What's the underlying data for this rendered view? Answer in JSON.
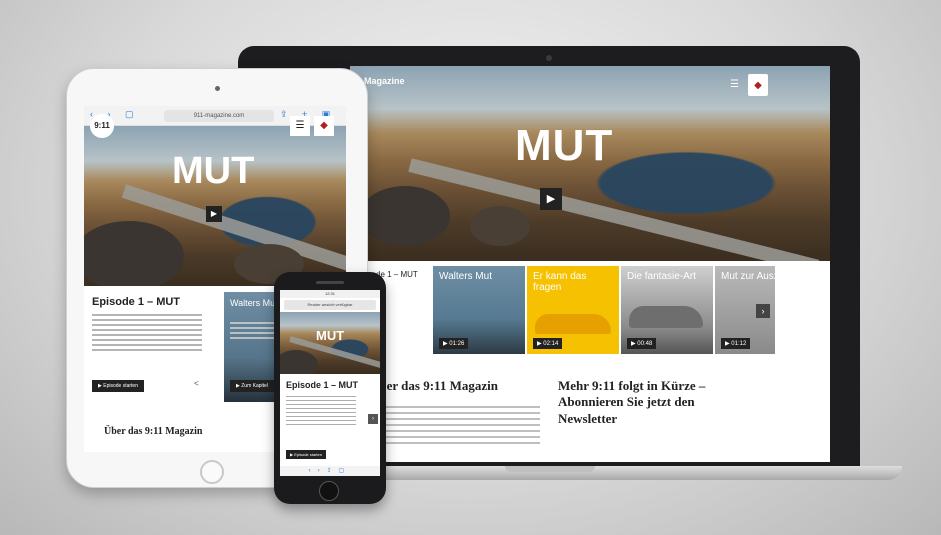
{
  "laptop": {
    "hero_title": "MUT",
    "site_logo": "Magazine",
    "play_icon": "play-icon",
    "cards": [
      {
        "title": "Episode 1 – MUT",
        "tag": ""
      },
      {
        "title": "Walters Mut",
        "tag": "▶ 01:26"
      },
      {
        "title": "Er kann das fragen",
        "tag": "▶ 02:14"
      },
      {
        "title": "Die fantasie-Art",
        "tag": "▶ 00:48"
      },
      {
        "title": "Mut zur Auszeit",
        "tag": "▶ 01:12"
      }
    ],
    "section_about": "Über das 9:11 Magazin",
    "section_newsletter": "Mehr 9:11 folgt in Kürze – Abonnieren Sie jetzt den Newsletter"
  },
  "tablet": {
    "url": "911-magazine.com",
    "logo": "9:11",
    "hero_title": "MUT",
    "episode_title": "Episode 1 – MUT",
    "start_button": "▶ Episode starten",
    "card_title": "Walters Mut",
    "chapter_button": "▶ Zum Kapitel",
    "about_title": "Über das 9:11 Magazin"
  },
  "phone": {
    "status": "12:31",
    "url": "Reader ansicht verfügbar",
    "hero_title": "MUT",
    "episode_title": "Episode 1 – MUT",
    "start_button": "▶ Episode starten"
  },
  "colors": {
    "card_yellow": "#f5c100",
    "device_dark": "#1d1d1f",
    "link_blue": "#2a7be0"
  }
}
